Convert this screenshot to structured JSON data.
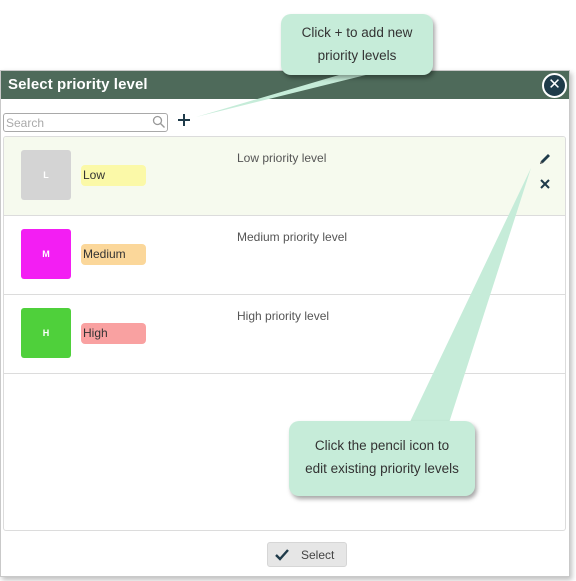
{
  "dialog": {
    "title": "Select priority level",
    "close_icon": "close-icon",
    "search": {
      "placeholder": "Search",
      "value": "",
      "icon": "search-icon"
    },
    "add_icon": "plus-icon",
    "items": [
      {
        "letter": "L",
        "name": "Low",
        "description": "Low priority level",
        "swatch_color": "#d4d4d4",
        "badge_color": "#fbf9a8",
        "selected": true
      },
      {
        "letter": "M",
        "name": "Medium",
        "description": "Medium priority level",
        "swatch_color": "#f31ef3",
        "badge_color": "#fbd79a",
        "selected": false
      },
      {
        "letter": "H",
        "name": "High",
        "description": "High priority level",
        "swatch_color": "#4fd03b",
        "badge_color": "#f9a1a1",
        "selected": false
      }
    ],
    "row_actions": {
      "edit_icon": "pencil-icon",
      "delete_icon": "close-icon"
    },
    "select_button": {
      "label": "Select",
      "icon": "check-icon"
    }
  },
  "callouts": {
    "add": {
      "line1": "Click + to add new",
      "line2": "priority levels"
    },
    "edit": {
      "line1": "Click the pencil icon to",
      "line2": "edit existing priority levels"
    }
  },
  "colors": {
    "titlebar": "#4e6a5a",
    "callout": "#c6ecd9",
    "selected_row": "#f6faee"
  }
}
